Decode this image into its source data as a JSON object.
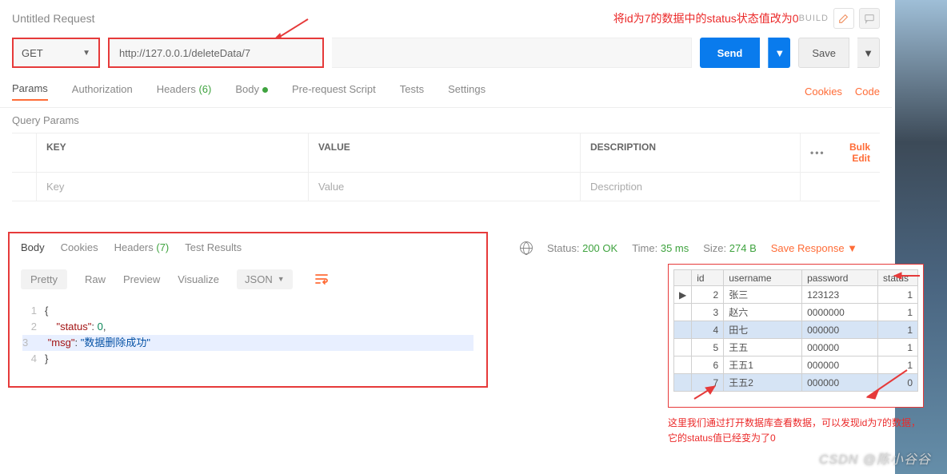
{
  "header": {
    "request_title": "Untitled Request",
    "annotation_top": "将id为7的数据中的status状态值改为0",
    "build": "BUILD"
  },
  "request": {
    "method": "GET",
    "url": "http://127.0.0.1/deleteData/7",
    "send": "Send",
    "save": "Save"
  },
  "tabs": {
    "params": "Params",
    "authorization": "Authorization",
    "headers": "Headers",
    "headers_count": "(6)",
    "body": "Body",
    "prereq": "Pre-request Script",
    "tests": "Tests",
    "settings": "Settings",
    "cookies_link": "Cookies",
    "code_link": "Code"
  },
  "query_params": {
    "title": "Query Params",
    "col_key": "KEY",
    "col_value": "VALUE",
    "col_desc": "DESCRIPTION",
    "bulk_edit": "Bulk Edit",
    "row_key_placeholder": "Key",
    "row_value_placeholder": "Value",
    "row_desc_placeholder": "Description"
  },
  "response": {
    "tabs": {
      "body": "Body",
      "cookies": "Cookies",
      "headers": "Headers",
      "headers_count": "(7)",
      "tests": "Test Results"
    },
    "toolbar": {
      "pretty": "Pretty",
      "raw": "Raw",
      "preview": "Preview",
      "visualize": "Visualize",
      "format": "JSON"
    },
    "body_json": {
      "line1": "{",
      "line2_key": "\"status\"",
      "line2_sep": ": ",
      "line2_val": "0",
      "line2_end": ",",
      "line3_key": "\"msg\"",
      "line3_sep": ": ",
      "line3_val": "\"数据删除成功\"",
      "line4": "}"
    }
  },
  "status": {
    "status_label": "Status:",
    "status_val": "200 OK",
    "time_label": "Time:",
    "time_val": "35 ms",
    "size_label": "Size:",
    "size_val": "274 B",
    "save_response": "Save Response"
  },
  "db": {
    "cols": {
      "id": "id",
      "username": "username",
      "password": "password",
      "status": "status"
    },
    "rows": [
      {
        "id": "2",
        "u": "张三",
        "p": "123123",
        "s": "1"
      },
      {
        "id": "3",
        "u": "赵六",
        "p": "0000000",
        "s": "1"
      },
      {
        "id": "4",
        "u": "田七",
        "p": "000000",
        "s": "1"
      },
      {
        "id": "5",
        "u": "王五",
        "p": "000000",
        "s": "1"
      },
      {
        "id": "6",
        "u": "王五1",
        "p": "000000",
        "s": "1"
      },
      {
        "id": "7",
        "u": "王五2",
        "p": "000000",
        "s": "0"
      }
    ]
  },
  "annotation_bottom": "这里我们通过打开数据库查看数据，可以发现id为7的数据，它的status值已经变为了0",
  "watermark": "CSDN @陈小谷谷"
}
